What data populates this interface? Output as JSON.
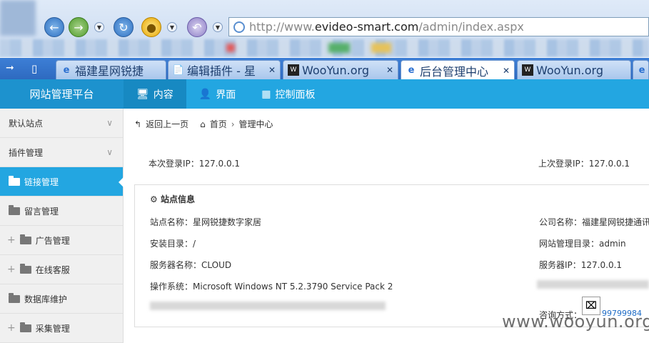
{
  "browser": {
    "address_prefix": "http://www.",
    "address_host": "evideo-smart.com",
    "address_path": "/admin/index.aspx"
  },
  "tabs": [
    {
      "title": "福建星网锐捷",
      "icon": "ie-icon",
      "active": false
    },
    {
      "title": "编辑插件 - 星",
      "icon": "page-icon",
      "active": false
    },
    {
      "title": "WooYun.org",
      "icon": "wooyun-icon",
      "active": false
    },
    {
      "title": "后台管理中心",
      "icon": "ie-icon",
      "active": true
    },
    {
      "title": "WooYun.org",
      "icon": "wooyun-icon",
      "active": false
    }
  ],
  "app": {
    "brand": "网站管理平台",
    "top_nav": [
      {
        "label": "内容",
        "icon": "monitor-icon",
        "active": true
      },
      {
        "label": "界面",
        "icon": "user-icon",
        "active": false
      },
      {
        "label": "控制面板",
        "icon": "control-panel-icon",
        "active": false
      }
    ]
  },
  "sidebar": {
    "items": [
      {
        "label": "默认站点",
        "type": "group"
      },
      {
        "label": "插件管理",
        "type": "group"
      },
      {
        "label": "链接管理",
        "type": "folder",
        "active": true
      },
      {
        "label": "留言管理",
        "type": "folder"
      },
      {
        "label": "广告管理",
        "type": "folder-plus"
      },
      {
        "label": "在线客服",
        "type": "folder-plus"
      },
      {
        "label": "数据库维护",
        "type": "folder"
      },
      {
        "label": "采集管理",
        "type": "folder-plus"
      }
    ]
  },
  "breadcrumb": {
    "back": "返回上一页",
    "home": "首页",
    "current": "管理中心"
  },
  "login": {
    "this_login": "本次登录IP：127.0.0.1",
    "last_login": "上次登录IP：127.0.0.1"
  },
  "site_info": {
    "title": "站点信息",
    "site_name": "站点名称：星网锐捷数字家居",
    "install_dir": "安装目录：/",
    "server_name": "服务器名称：CLOUD",
    "os": "操作系统：Microsoft Windows NT 5.2.3790 Service Pack 2",
    "company": "公司名称：福建星网锐捷通讯",
    "admin_dir": "网站管理目录：admin",
    "server_ip": "服务器IP：127.0.0.1",
    "consult": "咨询方式：",
    "qq": "99799984"
  },
  "watermark": "www.wooyun.org"
}
